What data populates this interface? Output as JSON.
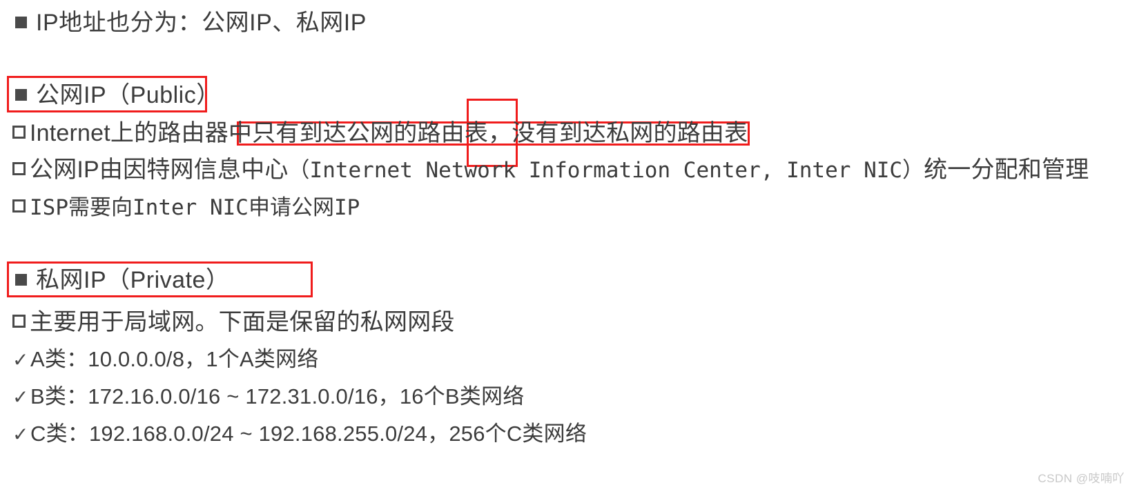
{
  "slide": {
    "background_color": "#ffffff",
    "text_color": "#3c3c3c",
    "highlight_color": "#f01c1c"
  },
  "content": {
    "intro": {
      "bullet": "square-filled",
      "text": "IP地址也分为：公网IP、私网IP"
    },
    "public_section": {
      "heading": {
        "bullet": "square-filled",
        "text": "公网IP（Public）",
        "highlighted": true
      },
      "points": [
        {
          "bullet": "square-hollow",
          "text": "Internet上的路由器中只有到达公网的路由表，没有到达私网的路由表",
          "highlighted": true
        },
        {
          "bullet": "square-hollow",
          "text_prefix": "公网IP由因特网信息中心",
          "text_mono": "（Internet Network Information Center, Inter NIC）",
          "text_suffix": "统一分配和管理",
          "highlighted": false
        },
        {
          "bullet": "square-hollow",
          "text": "ISP需要向Inter NIC申请公网IP",
          "highlighted": false
        }
      ]
    },
    "private_section": {
      "heading": {
        "bullet": "square-filled",
        "text": "私网IP（Private）",
        "highlighted": true
      },
      "points": [
        {
          "bullet": "square-hollow",
          "text": "主要用于局域网。下面是保留的私网网段"
        }
      ],
      "classes": [
        {
          "bullet": "check",
          "text": "A类：10.0.0.0/8，1个A类网络"
        },
        {
          "bullet": "check",
          "text": "B类：172.16.0.0/16 ~ 172.31.0.0/16，16个B类网络"
        },
        {
          "bullet": "check",
          "text": "C类：192.168.0.0/24 ~ 192.168.255.0/24，256个C类网络"
        }
      ]
    }
  },
  "annotations": {
    "box_public_heading": {
      "label": "red-box-around-public-ip-heading"
    },
    "box_routing_line": {
      "label": "red-box-around-routing-table-sentence"
    },
    "box_no_private_route": {
      "label": "red-box-around-mei-you"
    },
    "box_private_heading": {
      "label": "red-box-around-private-ip-heading"
    }
  },
  "watermark": {
    "text": "CSDN @吱喃吖"
  },
  "icons": {
    "check": "✓",
    "square_filled": "■",
    "square_hollow": "□"
  }
}
